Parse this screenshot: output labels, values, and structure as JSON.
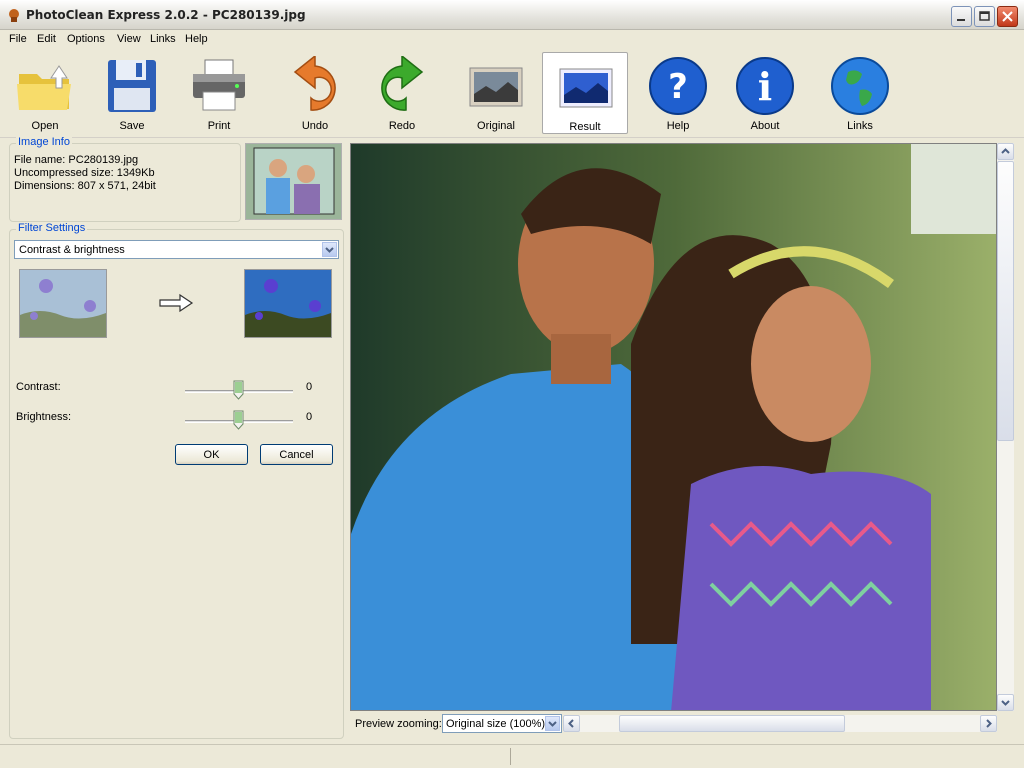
{
  "window": {
    "title": "PhotoClean Express 2.0.2 - PC280139.jpg"
  },
  "menu": [
    "File",
    "Edit",
    "Options",
    "View",
    "Links",
    "Help"
  ],
  "toolbar": {
    "open": "Open",
    "save": "Save",
    "print": "Print",
    "undo": "Undo",
    "redo": "Redo",
    "original": "Original",
    "result": "Result",
    "help": "Help",
    "about": "About",
    "links": "Links"
  },
  "image_info": {
    "title": "Image Info",
    "file_name": "File name: PC280139.jpg",
    "uncompressed_size": "Uncompressed size: 1349Kb",
    "dimensions": "Dimensions: 807 x 571, 24bit"
  },
  "filter": {
    "title": "Filter Settings",
    "selected": "Contrast & brightness",
    "contrast_label": "Contrast:",
    "contrast_value": "0",
    "brightness_label": "Brightness:",
    "brightness_value": "0",
    "ok": "OK",
    "cancel": "Cancel"
  },
  "preview": {
    "zoom_label": "Preview zooming:",
    "zoom_value": "Original size (100%)"
  },
  "colors": {
    "accent": "#0046d5",
    "select_border": "#7f9db9"
  }
}
